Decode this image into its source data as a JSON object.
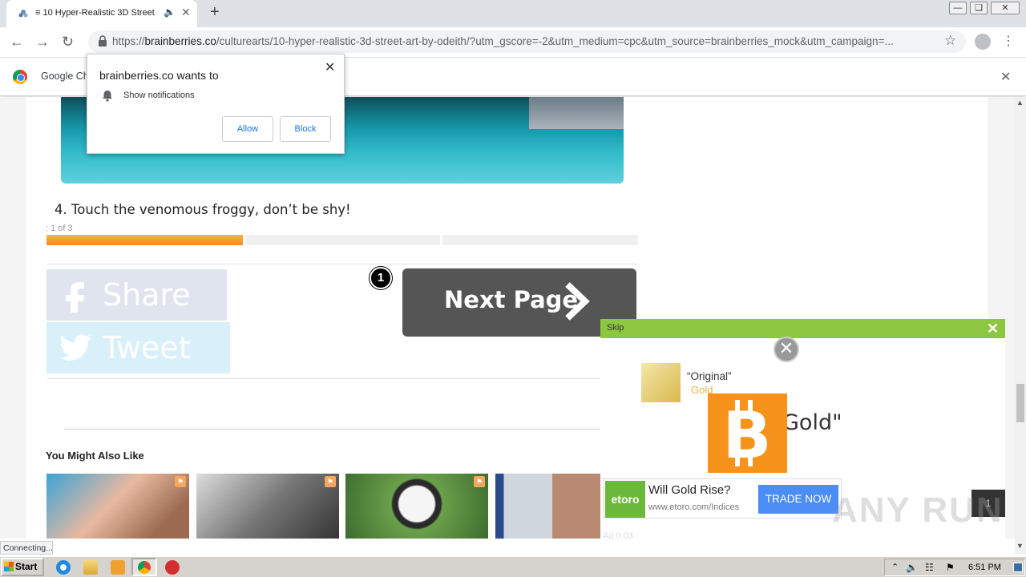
{
  "browser": {
    "tab_title": "≡ 10 Hyper-Realistic 3D Street",
    "new_tab": "+",
    "url_prefix": "https://",
    "url_host": "brainberries.co",
    "url_rest": "/culturearts/10-hyper-realistic-3d-street-art-by-odeith/?utm_gscore=-2&utm_medium=cpc&utm_source=brainberries_mock&utm_campaign=...",
    "infobar_text": "Google Ch",
    "status_text": "Connecting...",
    "window_controls": [
      "—",
      "❏",
      "✕"
    ]
  },
  "notification": {
    "title": "brainberries.co wants to",
    "permission": "Show notifications",
    "allow_label": "Allow",
    "block_label": "Block"
  },
  "article": {
    "caption": "4. Touch the venomous froggy, don’t be shy!",
    "progress_label": ": 1 of 3",
    "progress_current": 1,
    "progress_total": 3,
    "share_facebook": "Share",
    "share_twitter": "Tweet",
    "badge_number": "1",
    "next_page_label": "Next Page",
    "related_heading": "You Might Also Like"
  },
  "ad": {
    "skip_label": "Skip",
    "gold_original": "“Original”",
    "gold_word": "Gold",
    "headline_fragment": "Gold\"",
    "etoro_logo": "etoro",
    "etoro_headline": "Will Gold Rise?",
    "etoro_url": "www.etoro.com/Indices",
    "trade_label": "TRADE NOW",
    "ad_time": "Ad  0:03",
    "dark_box_label": "1"
  },
  "watermark": "ANY RUN",
  "taskbar": {
    "start_label": "Start",
    "clock": "6:51 PM"
  },
  "colors": {
    "accent_green": "#8dc640",
    "progress_orange": "#ee8a2e",
    "bitcoin_orange": "#f7931a",
    "trade_blue": "#4c8df5"
  }
}
